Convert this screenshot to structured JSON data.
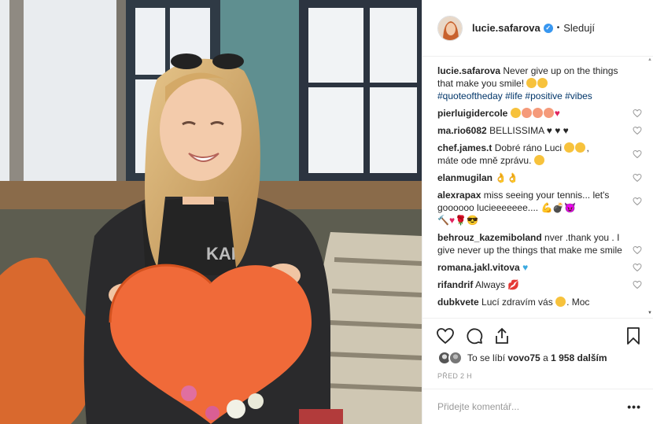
{
  "colors": {
    "accent": "#3897f0",
    "text": "#262626",
    "muted": "#999999",
    "hashtag": "#003569",
    "heart_red": "#e0245e",
    "heart_blue": "#3aa9e0"
  },
  "post": {
    "author": "lucie.safarova",
    "separator": "•",
    "follow_label": "Sledují",
    "caption": {
      "user": "lucie.safarova",
      "text": "Never give up on the things that make you smile!",
      "hashtags": "#quoteoftheday #life #positive #vibes"
    }
  },
  "comments": [
    {
      "user": "pierluigidercole",
      "text": ""
    },
    {
      "user": "ma.rio6082",
      "text": "BELLISSIMA ♥ ♥ ♥"
    },
    {
      "user": "chef.james.t",
      "text": "Dobré ráno Luci",
      "text2": "máte ode mně zprávu."
    },
    {
      "user": "elanmugilan",
      "text": "👌👌"
    },
    {
      "user": "alexrapax",
      "text": "miss seeing your tennis... let's goooooo lucieeeeeee...."
    },
    {
      "user": "behrouz_kazemiboland",
      "text": "nver .thank you . I give never up the things that make me smile"
    },
    {
      "user": "romana.jakl.vitova",
      "text": ""
    },
    {
      "user": "rifandrif",
      "text": "Always"
    },
    {
      "user": "dubkvete",
      "text": "Lucí zdravím vás",
      "text2": ". Moc"
    }
  ],
  "likes": {
    "prefix": "To se líbí",
    "user": "vovo75",
    "middle": "a",
    "count": "1 958",
    "suffix": "dalším"
  },
  "timestamp": "PŘED 2 H",
  "add_comment": {
    "placeholder": "Přidejte komentář..."
  },
  "more_label": "•••",
  "icons": [
    "heart-outline-icon",
    "comment-bubble-icon",
    "share-icon",
    "bookmark-icon",
    "verified-badge-icon"
  ]
}
